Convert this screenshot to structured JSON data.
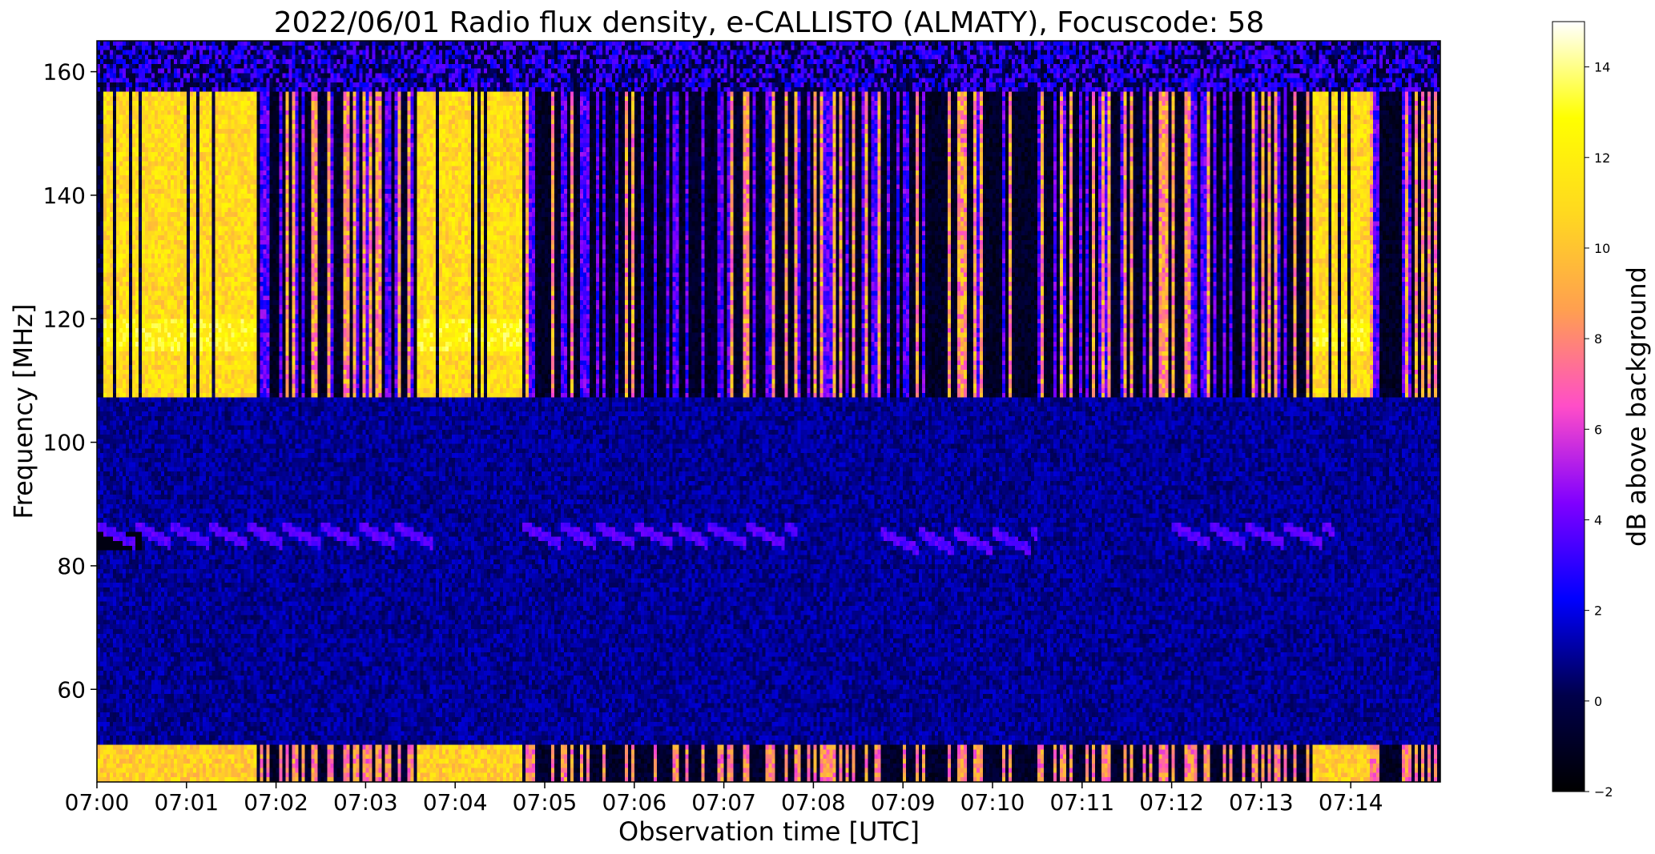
{
  "chart_data": {
    "type": "heatmap",
    "title": "2022/06/01  Radio flux density, e-CALLISTO (ALMATY), Focuscode: 58",
    "xlabel": "Observation time [UTC]",
    "ylabel": "Frequency [MHz]",
    "colorbar_label": "dB above background",
    "xlim": [
      "07:00:00",
      "07:15:00"
    ],
    "ylim": [
      45,
      165
    ],
    "x_ticks": [
      "07:00",
      "07:01",
      "07:02",
      "07:03",
      "07:04",
      "07:05",
      "07:06",
      "07:07",
      "07:08",
      "07:09",
      "07:10",
      "07:11",
      "07:12",
      "07:13",
      "07:14"
    ],
    "y_ticks": [
      60,
      80,
      100,
      120,
      140,
      160
    ],
    "colorbar_range": [
      -2,
      15
    ],
    "colorbar_ticks": [
      -2,
      0,
      2,
      4,
      6,
      8,
      10,
      12,
      14
    ],
    "colormap_stops": [
      "#000000",
      "#00004b",
      "#0000ff",
      "#8000ff",
      "#ff4dc8",
      "#ff9f50",
      "#ffd820",
      "#ffff00",
      "#ffffff"
    ],
    "bright_intervals": [
      {
        "start": "07:00:00",
        "end": "07:01:47"
      },
      {
        "start": "07:03:35",
        "end": "07:04:45"
      },
      {
        "start": "07:13:35",
        "end": "07:14:12"
      }
    ],
    "bright_band_mhz": [
      107,
      157
    ],
    "low_band_mhz": [
      45,
      51
    ],
    "interference_band_mhz": [
      157,
      165
    ],
    "tracks_mhz": [
      {
        "start": "07:00:00",
        "end": "07:03:45",
        "center": 84
      },
      {
        "start": "07:04:45",
        "end": "07:07:50",
        "center": 84
      },
      {
        "start": "07:08:45",
        "end": "07:10:30",
        "center": 83
      },
      {
        "start": "07:12:00",
        "end": "07:13:50",
        "center": 84
      }
    ]
  }
}
